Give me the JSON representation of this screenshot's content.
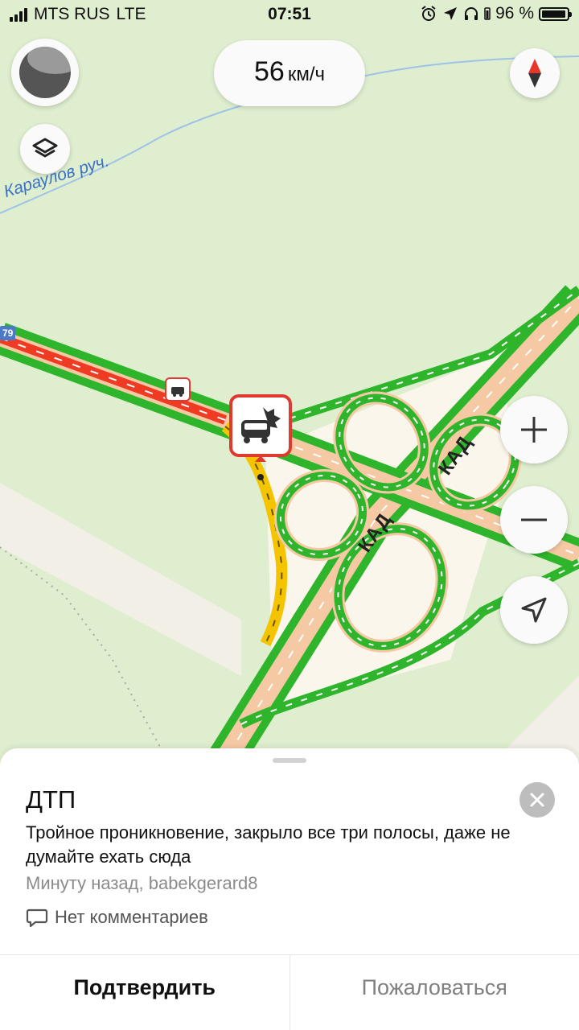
{
  "status_bar": {
    "carrier": "MTS RUS",
    "network": "LTE",
    "time": "07:51",
    "battery_percent": "96 %",
    "battery_level": 0.96,
    "icons": [
      "alarm-icon",
      "location-arrow-icon",
      "headphones-icon",
      "battery-icon"
    ]
  },
  "map": {
    "speed_value": "56",
    "speed_unit": "км/ч",
    "river_label": "Караулов руч.",
    "road_labels": [
      "КАД",
      "КАД"
    ],
    "route_shield": "79",
    "buttons": {
      "profile": "profile-avatar",
      "layers": "layers-icon",
      "compass": "compass-icon",
      "zoom_in": "+",
      "zoom_out": "−",
      "locate": "navigation-arrow-icon"
    },
    "colors": {
      "background": "#dfeecf",
      "traffic_free": "#2fb52b",
      "traffic_slow": "#f5c400",
      "traffic_jam": "#ef3b24",
      "road_fill": "#f5c9a4",
      "incident_border": "#e03a30"
    }
  },
  "incident": {
    "title": "ДТП",
    "description": "Тройное проникновение, закрыло все три полосы, даже не думайте ехать сюда",
    "meta": "Минуту назад, babekgerard8",
    "comments_label": "Нет комментариев",
    "confirm_label": "Подтвердить",
    "report_label": "Пожаловаться"
  }
}
